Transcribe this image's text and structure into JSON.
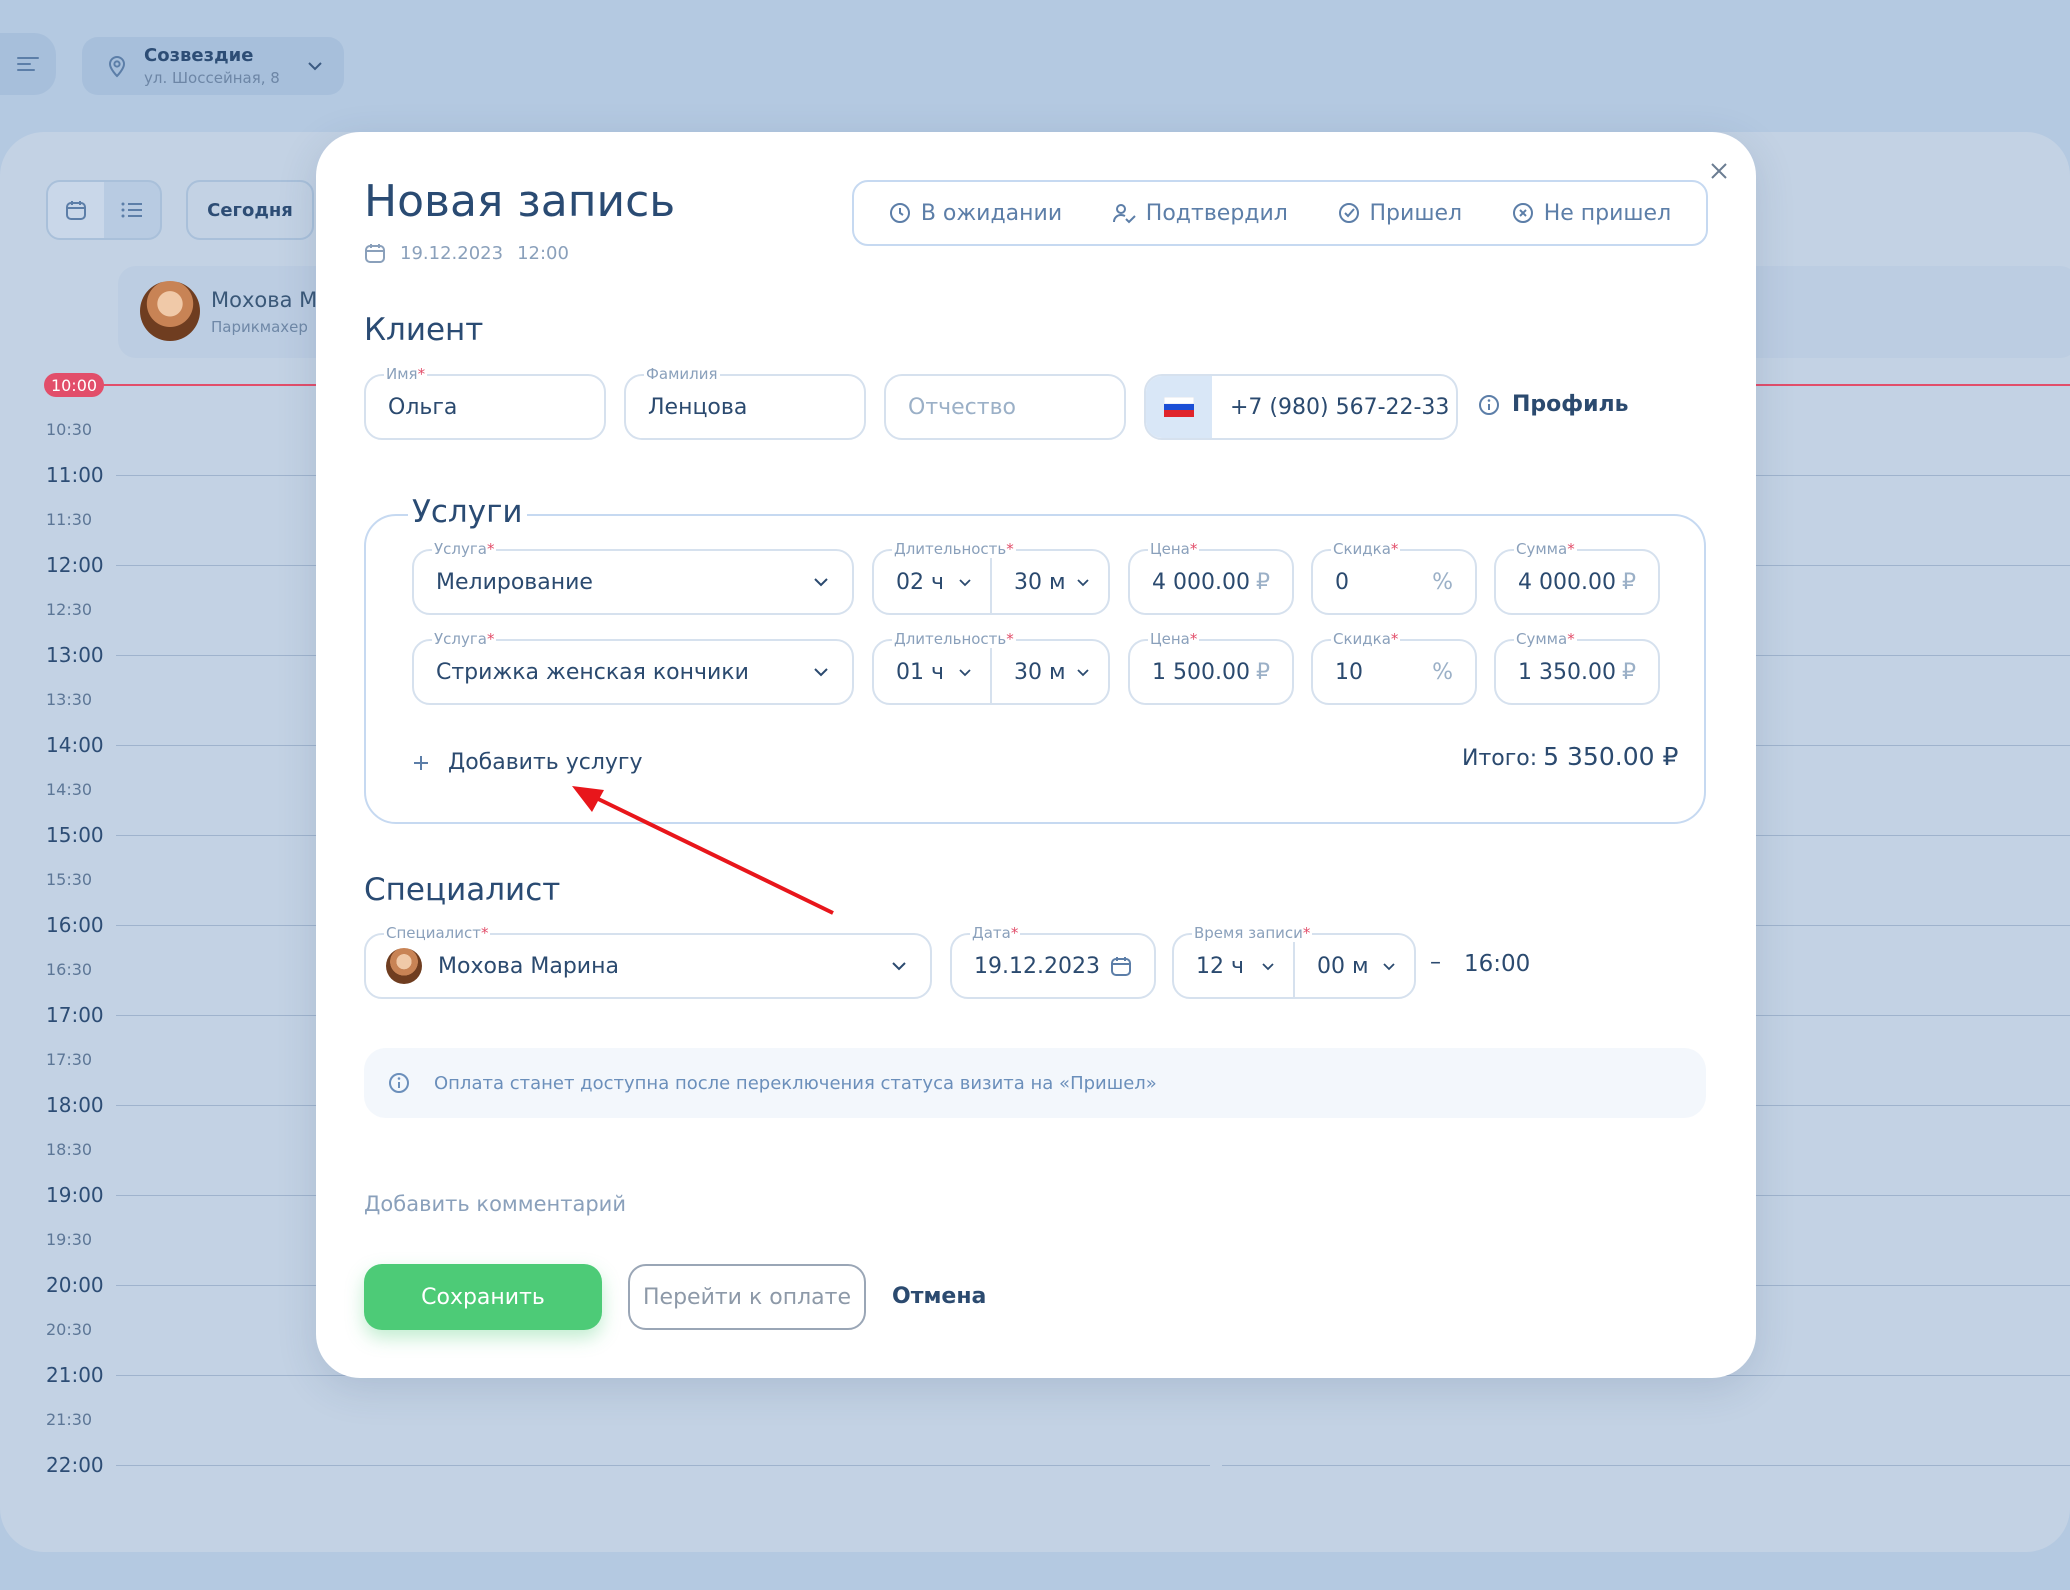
{
  "location": {
    "name": "Созвездие",
    "address": "ул. Шоссейная, 8"
  },
  "toolbar": {
    "today": "Сегодня"
  },
  "specialist_card": {
    "name": "Мохова М",
    "role": "Парикмахер"
  },
  "now_time": "10:00",
  "time_labels": [
    "10:30",
    "11:00",
    "11:30",
    "12:00",
    "12:30",
    "13:00",
    "13:30",
    "14:00",
    "14:30",
    "15:00",
    "15:30",
    "16:00",
    "16:30",
    "17:00",
    "17:30",
    "18:00",
    "18:30",
    "19:00",
    "19:30",
    "20:00",
    "20:30",
    "21:00",
    "21:30",
    "22:00"
  ],
  "modal": {
    "title": "Новая запись",
    "date": "19.12.2023",
    "time": "12:00",
    "statuses": [
      "В ожидании",
      "Подтвердил",
      "Пришел",
      "Не пришел"
    ],
    "client": {
      "heading": "Клиент",
      "first_name_label": "Имя",
      "first_name": "Ольга",
      "last_name_label": "Фамилия",
      "last_name": "Ленцова",
      "middle_name_placeholder": "Отчество",
      "phone": "+7 (980) 567-22-33",
      "profile_label": "Профиль"
    },
    "services": {
      "heading": "Услуги",
      "labels": {
        "service": "Услуга",
        "duration": "Длительность",
        "price": "Цена",
        "discount": "Скидка",
        "sum": "Сумма"
      },
      "rows": [
        {
          "service": "Мелирование",
          "hours": "02 ч",
          "minutes": "30 м",
          "price": "4 000.00",
          "discount": "0",
          "sum": "4 000.00"
        },
        {
          "service": "Стрижка женская кончики",
          "hours": "01 ч",
          "minutes": "30 м",
          "price": "1 500.00",
          "discount": "10",
          "sum": "1 350.00"
        }
      ],
      "currency": "₽",
      "percent": "%",
      "add_label": "Добавить услугу",
      "total_label": "Итого:",
      "total_value": "5 350.00 ₽"
    },
    "specialist": {
      "heading": "Специалист",
      "label": "Специалист",
      "name": "Мохова Марина",
      "date_label": "Дата",
      "date": "19.12.2023",
      "time_label": "Время записи",
      "hours": "12 ч",
      "minutes": "00 м",
      "dash": "–",
      "end_time": "16:00"
    },
    "info_text": "Оплата станет доступна после переключения статуса визита на «Пришел»",
    "add_comment": "Добавить комментарий",
    "buttons": {
      "save": "Сохранить",
      "pay": "Перейти к оплате",
      "cancel": "Отмена"
    }
  },
  "colors": {
    "accent": "#4dcb77",
    "annotation_arrow": "#e8161b",
    "required": "#e24e6a"
  }
}
